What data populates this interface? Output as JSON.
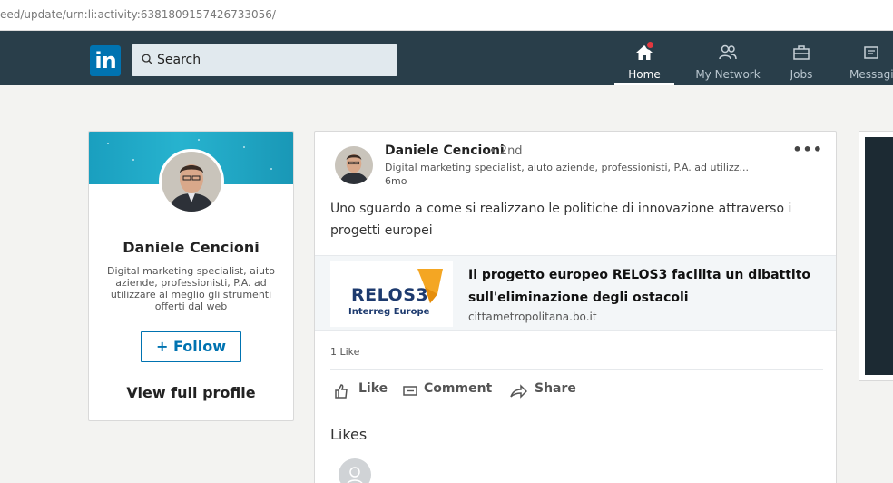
{
  "browser": {
    "url": "eed/update/urn:li:activity:6381809157426733056/"
  },
  "nav": {
    "logo": "in",
    "search_placeholder": "Search",
    "items": [
      {
        "label": "Home",
        "icon": "home-icon",
        "active": true
      },
      {
        "label": "My Network",
        "icon": "network-icon",
        "active": false
      },
      {
        "label": "Jobs",
        "icon": "briefcase-icon",
        "active": false
      },
      {
        "label": "Messagi",
        "icon": "messaging-icon",
        "active": false
      }
    ]
  },
  "profile_card": {
    "name": "Daniele Cencioni",
    "description": "Digital marketing specialist, aiuto aziende, professionisti, P.A. ad utilizzare al meglio gli strumenti offerti dal web",
    "follow_label": "+ Follow",
    "view_profile_label": "View full profile"
  },
  "post": {
    "author": "Daniele Cencioni",
    "degree": "• 2nd",
    "headline": "Digital marketing specialist, aiuto aziende, professionisti, P.A. ad utilizz...",
    "time": "6mo",
    "more": "•••",
    "text": "Uno sguardo a come si realizzano le politiche di innovazione attraverso i progetti europei",
    "link": {
      "thumb_title": "RELOS3",
      "thumb_subtitle": "Interreg Europe",
      "title": "Il progetto europeo RELOS3 facilita un dibattito sull'eliminazione degli ostacoli",
      "domain": "cittametropolitana.bo.it"
    },
    "likes_count": "1 Like",
    "actions": {
      "like": "Like",
      "comment": "Comment",
      "share": "Share"
    },
    "likes_heading": "Likes"
  },
  "colors": {
    "nav_bg": "#293e4a",
    "brand_blue": "#0073b1",
    "notification_red": "#e2383f",
    "relos_orange": "#f4a623"
  }
}
